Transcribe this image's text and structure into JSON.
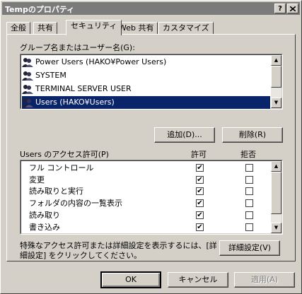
{
  "window": {
    "title": "Tempのプロパティ",
    "help_button": "?",
    "close_button": "X"
  },
  "tabs": [
    {
      "label": "全般"
    },
    {
      "label": "共有"
    },
    {
      "label": "セキュリティ",
      "active": true
    },
    {
      "label": "Web 共有"
    },
    {
      "label": "カスタマイズ"
    }
  ],
  "group_list": {
    "label": "グループ名またはユーザー名(G):",
    "items": [
      {
        "name": "Power Users (HAKO¥Power Users)",
        "icon": "user-group-icon"
      },
      {
        "name": "SYSTEM",
        "icon": "user-group-icon"
      },
      {
        "name": "TERMINAL SERVER USER",
        "icon": "user-group-icon"
      },
      {
        "name": "Users (HAKO¥Users)",
        "icon": "user-group-icon",
        "selected": true
      }
    ]
  },
  "buttons": {
    "add": "追加(D)...",
    "remove": "削除(R)",
    "advanced": "詳細設定(V)",
    "ok": "OK",
    "cancel": "キャンセル",
    "apply": "適用(A)"
  },
  "permissions": {
    "label": "Users のアクセス許可(P)",
    "allow_header": "許可",
    "deny_header": "拒否",
    "items": [
      {
        "name": "フル コントロール",
        "allow": true,
        "deny": false
      },
      {
        "name": "変更",
        "allow": true,
        "deny": false
      },
      {
        "name": "読み取りと実行",
        "allow": true,
        "deny": false
      },
      {
        "name": "フォルダの内容の一覧表示",
        "allow": true,
        "deny": false
      },
      {
        "name": "読み取り",
        "allow": true,
        "deny": false
      },
      {
        "name": "書き込み",
        "allow": true,
        "deny": false
      }
    ]
  },
  "advanced_note": {
    "line1": "特殊なアクセス許可または詳細設定を表示するには、[詳",
    "line2": "細設定] をクリックしてください。"
  },
  "colors": {
    "face": "#d4d0c8",
    "selection": "#0a246a",
    "titlebar": "#7b7b7b"
  }
}
